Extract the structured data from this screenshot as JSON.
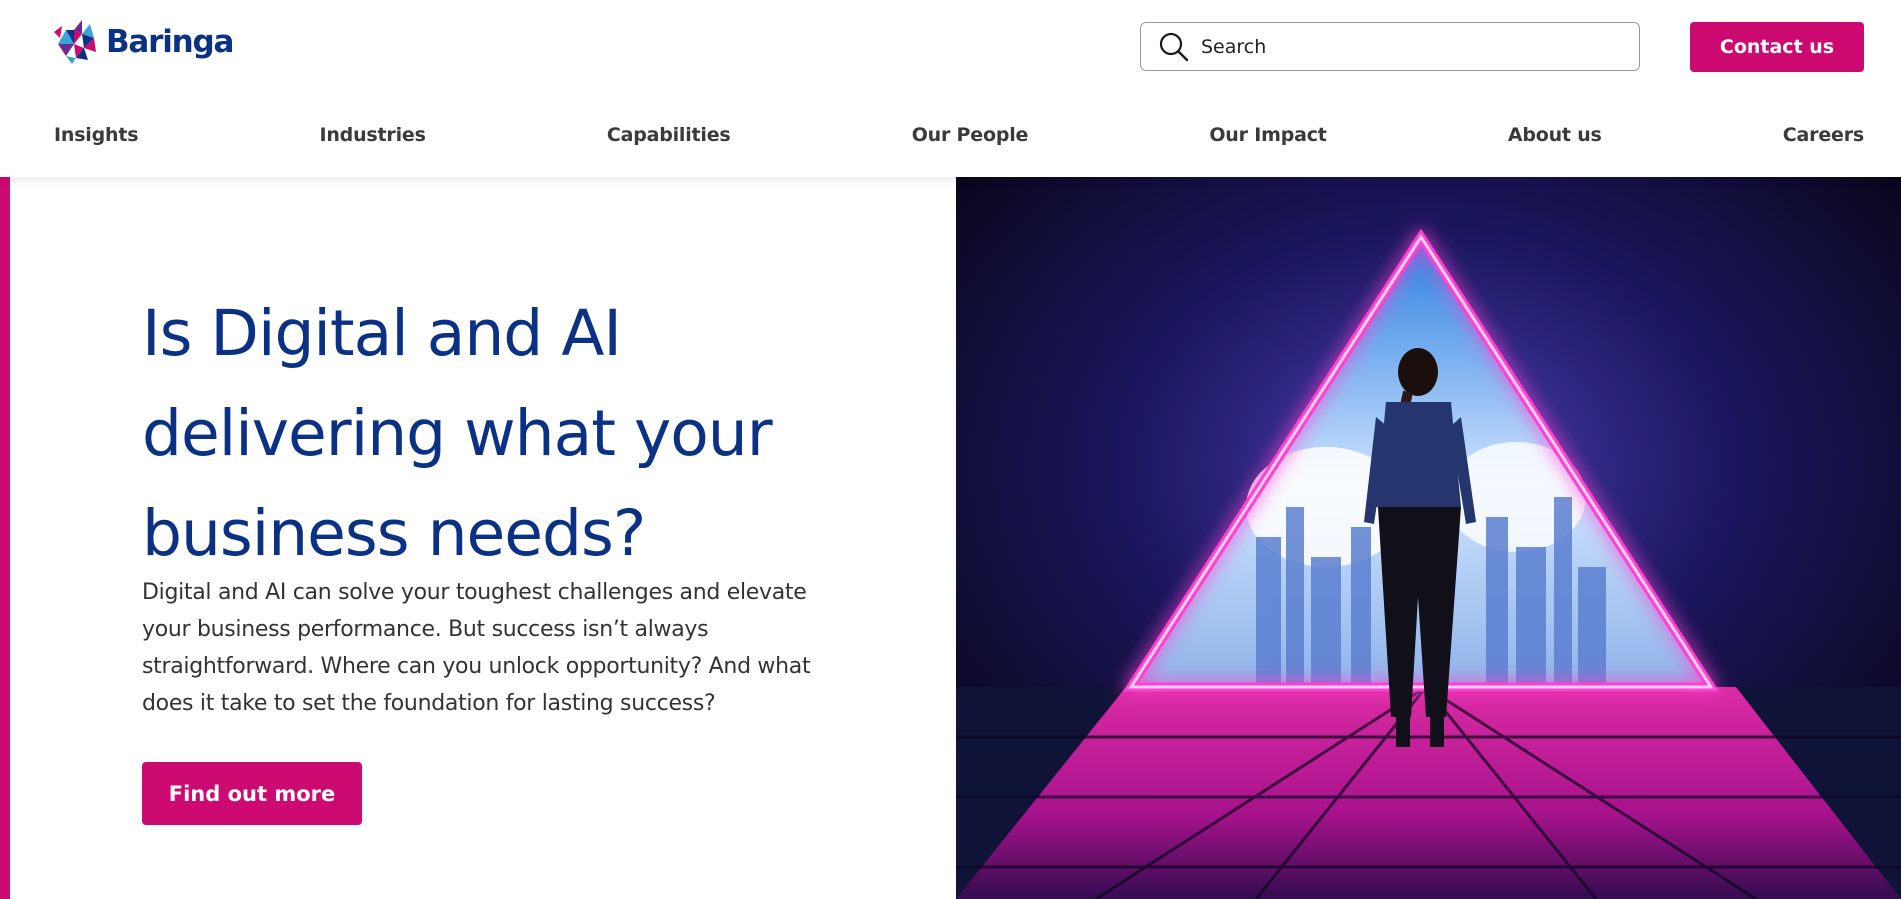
{
  "brand": {
    "name": "Baringa",
    "accent": "#cc0a72",
    "primary": "#0b3184"
  },
  "header": {
    "search": {
      "placeholder": "Search",
      "icon": "search-icon"
    },
    "contact_label": "Contact us"
  },
  "nav": {
    "items": [
      {
        "label": "Insights"
      },
      {
        "label": "Industries"
      },
      {
        "label": "Capabilities"
      },
      {
        "label": "Our People"
      },
      {
        "label": "Our Impact"
      },
      {
        "label": "About us"
      },
      {
        "label": "Careers"
      }
    ]
  },
  "hero": {
    "title": "Is Digital and AI delivering what your business needs?",
    "text": "Digital and AI can solve your toughest challenges and elevate your business performance. But success isn’t always straightforward. Where can you unlock opportunity? And what does it take to set the foundation for lasting success?",
    "cta_label": "Find out more"
  }
}
